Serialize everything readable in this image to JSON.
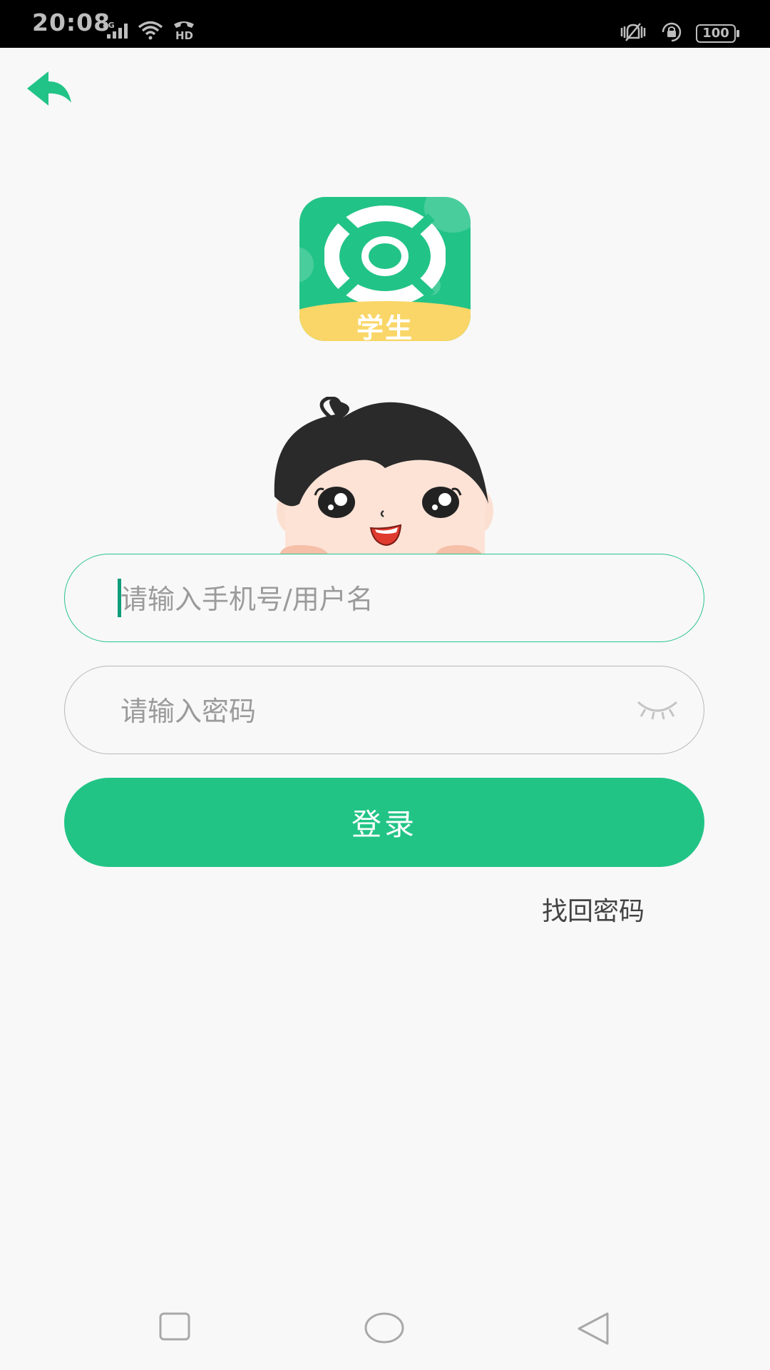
{
  "status_bar": {
    "time": "20:08",
    "network": "4G",
    "hd_label": "HD",
    "battery": "100"
  },
  "logo": {
    "label": "学生",
    "colors": {
      "primary": "#22c387",
      "band": "#f9d667"
    }
  },
  "form": {
    "username_placeholder": "请输入手机号/用户名",
    "password_placeholder": "请输入密码",
    "login_label": "登录",
    "forgot_label": "找回密码"
  },
  "theme": {
    "accent": "#22c486"
  },
  "icons": [
    "back-arrow-icon",
    "eye-closed-icon",
    "signal-icon",
    "wifi-icon",
    "hd-call-icon",
    "vibrate-icon",
    "rotation-lock-icon",
    "battery-icon",
    "recent-apps-icon",
    "home-icon",
    "back-icon"
  ]
}
